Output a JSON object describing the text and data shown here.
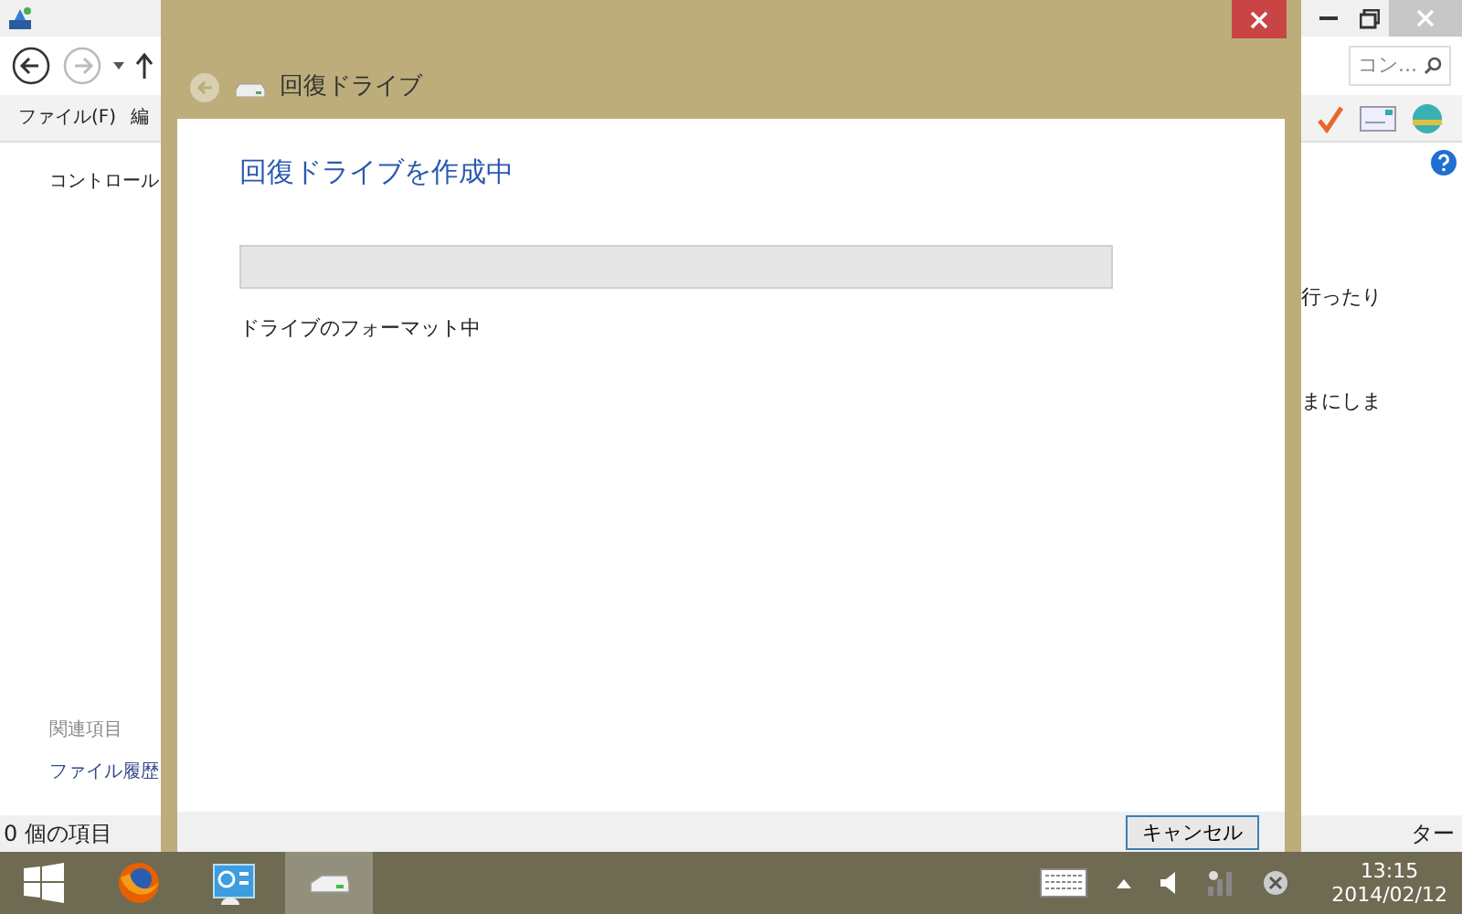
{
  "explorer": {
    "menu": [
      "ファイル(F)",
      "編"
    ],
    "search": {
      "placeholder": "コン..."
    },
    "breadcrumb": "コントロール",
    "side_heading": "関連項目",
    "side_link": "ファイル履歴",
    "body_fragments": [
      "行ったり",
      "まにしま"
    ],
    "status": "0 個の項目",
    "status_right": "ター"
  },
  "dialog": {
    "title": "回復ドライブ",
    "heading": "回復ドライブを作成中",
    "progress": {
      "level": 0
    },
    "status": "ドライブのフォーマット中",
    "buttons": [
      "キャンセル"
    ]
  },
  "taskbar": {
    "apps": [
      {
        "kind": "browser",
        "selected": false
      },
      {
        "kind": "control-panel",
        "selected": false
      },
      {
        "kind": "drive",
        "selected": true
      }
    ],
    "time": "13:15",
    "date": "2014/02/12"
  }
}
